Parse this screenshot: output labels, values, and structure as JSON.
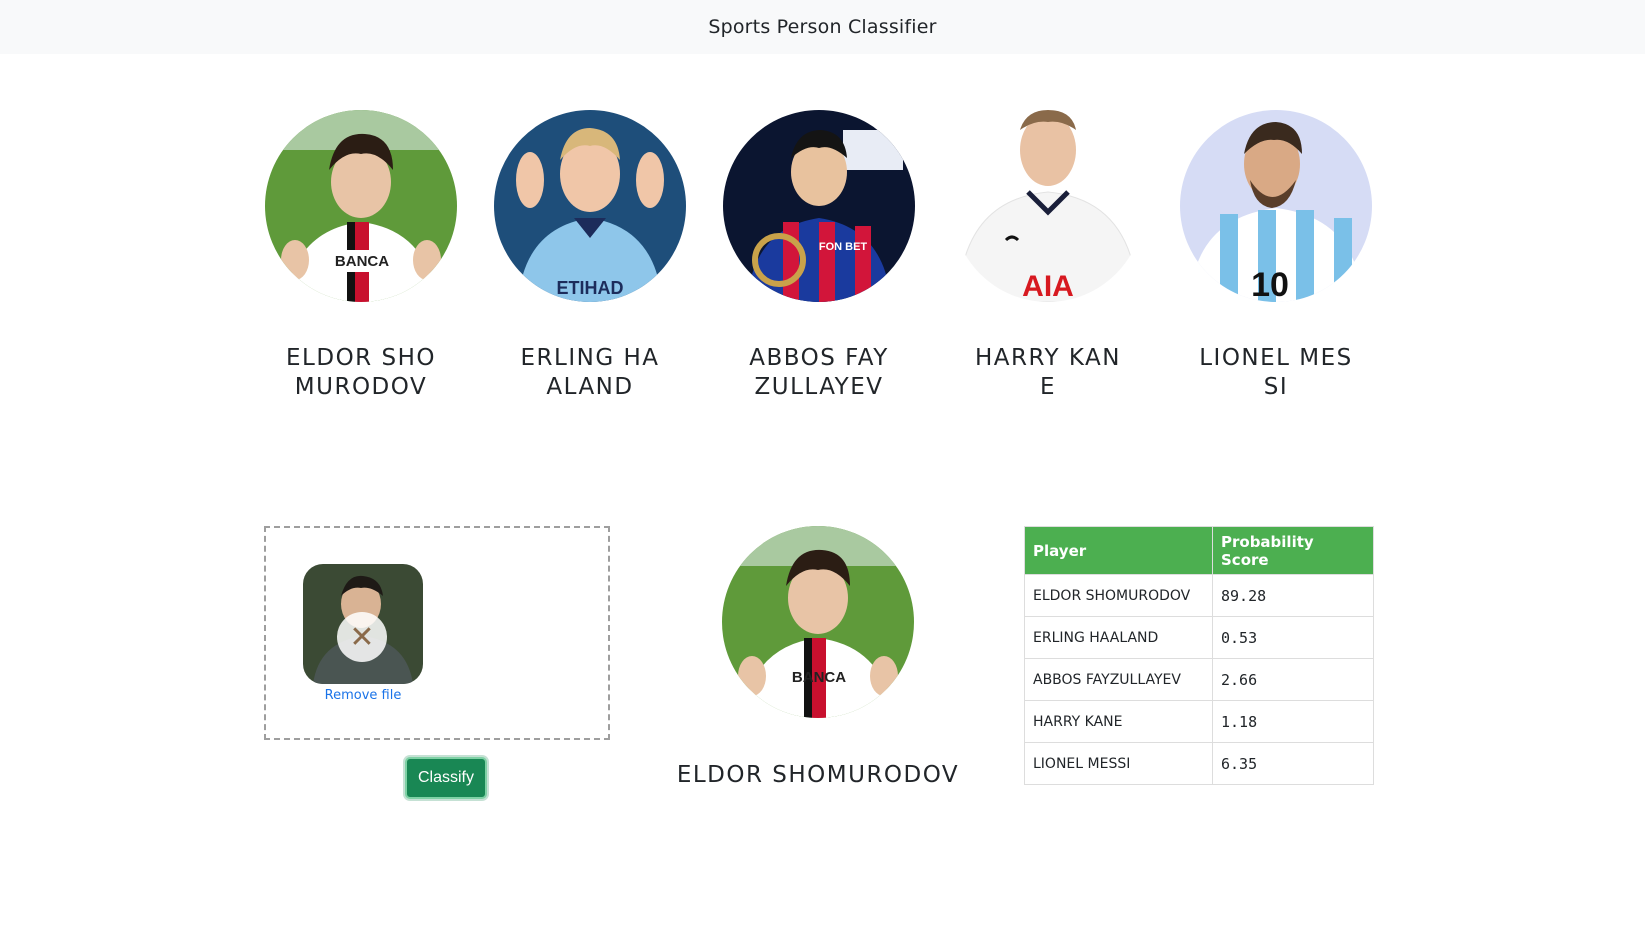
{
  "navbar": {
    "title": "Sports Person Classifier"
  },
  "players": [
    {
      "name": "Eldor Shomurodov",
      "jersey": "BANCA",
      "kit_primary": "#ffffff",
      "kit_accent": "#c8102e",
      "bg": "#5f9a3a"
    },
    {
      "name": "Erling Haaland",
      "jersey": "ETIHAD",
      "kit_primary": "#8ec6ea",
      "kit_accent": "#1c2c5b",
      "bg": "#1e4e7a"
    },
    {
      "name": "Abbos Fayzullayev",
      "jersey": "FON BET",
      "kit_primary": "#1a3a9e",
      "kit_accent": "#d2153a",
      "bg": "#0b1530"
    },
    {
      "name": "Harry Kane",
      "jersey": "AIA",
      "kit_primary": "#f5f5f5",
      "kit_accent": "#d71920",
      "bg": "#ffffff"
    },
    {
      "name": "Lionel Messi",
      "jersey": "10",
      "kit_primary": "#7ac0e8",
      "kit_accent": "#ffffff",
      "bg": "#d6dcf5"
    }
  ],
  "dropzone": {
    "remove_label": "Remove file",
    "remove_icon": "cigar-remove-icon"
  },
  "classify_button": {
    "label": "Classify",
    "color": "#198754"
  },
  "result": {
    "name": "Eldor Shomurodov"
  },
  "table": {
    "headers": [
      "Player",
      "Probability Score"
    ],
    "header_color": "#4caf50",
    "rows": [
      {
        "player": "ELDOR SHOMURODOV",
        "score": "89.28"
      },
      {
        "player": "ERLING HAALAND",
        "score": "0.53"
      },
      {
        "player": "ABBOS FAYZULLAYEV",
        "score": "2.66"
      },
      {
        "player": "HARRY KANE",
        "score": "1.18"
      },
      {
        "player": "LIONEL MESSI",
        "score": "6.35"
      }
    ]
  }
}
